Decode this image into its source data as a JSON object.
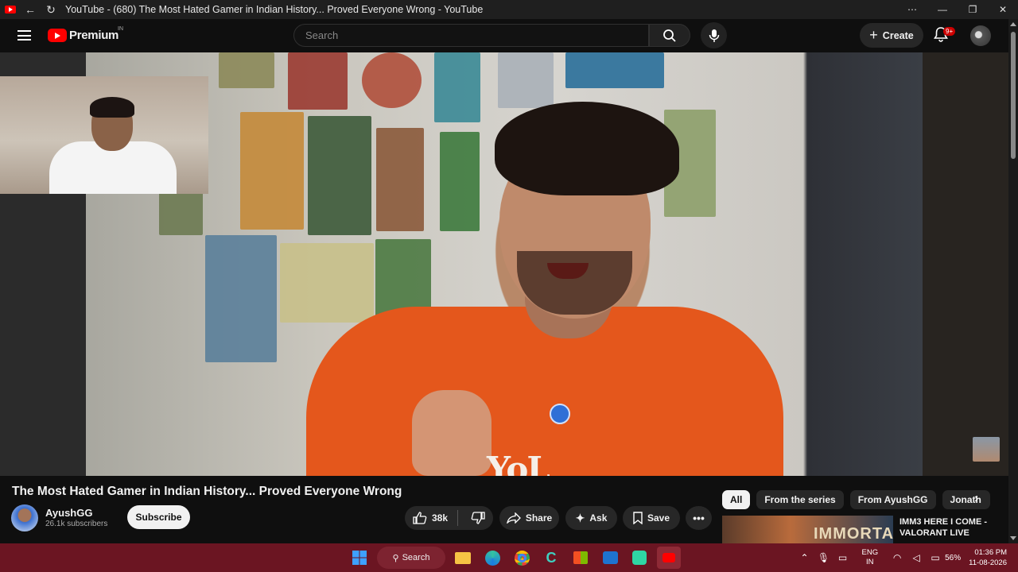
{
  "browser": {
    "tab_title": "YouTube - (680) The Most Hated Gamer in Indian History... Proved Everyone Wrong - YouTube"
  },
  "header": {
    "logo_text": "Premium",
    "region": "IN",
    "search_placeholder": "Search",
    "create_label": "Create",
    "notification_badge": "9+"
  },
  "video": {
    "title": "The Most Hated Gamer in Indian History... Proved Everyone Wrong",
    "channel_name": "AyushGG",
    "subscribers": "26.1k subscribers",
    "subscribe_label": "Subscribe",
    "likes": "38k",
    "share_label": "Share",
    "ask_label": "Ask",
    "save_label": "Save",
    "shirt_text": "YoL"
  },
  "sidebar": {
    "chips": [
      "All",
      "From the series",
      "From AyushGG",
      "Jonath"
    ],
    "recommendation_title": "IMM3 HERE I COME - VALORANT LIVE",
    "recommendation_thumb_text": "IMMORTAL"
  },
  "taskbar": {
    "search_label": "Search",
    "language": "ENG",
    "region": "IN",
    "battery": "56%",
    "time": "01:36 PM",
    "date": "11-08-2026"
  },
  "colors": {
    "accent_red": "#ff0000",
    "taskbar": "#6b1522",
    "shirt_orange": "#e45a1a"
  }
}
